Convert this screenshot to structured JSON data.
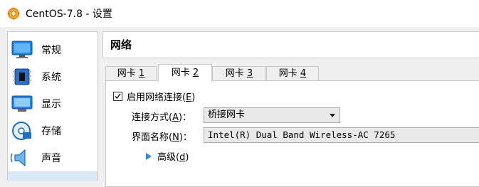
{
  "window": {
    "title": "CentOS-7.8 - 设置"
  },
  "sidebar": {
    "items": [
      {
        "label": "常规",
        "icon": "monitor-icon"
      },
      {
        "label": "系统",
        "icon": "chip-icon"
      },
      {
        "label": "显示",
        "icon": "display-icon"
      },
      {
        "label": "存储",
        "icon": "disk-icon"
      },
      {
        "label": "声音",
        "icon": "speaker-icon"
      }
    ]
  },
  "main": {
    "section_title": "网络",
    "tabs": [
      {
        "label": "网卡 ",
        "key": "1"
      },
      {
        "label": "网卡 ",
        "key": "2"
      },
      {
        "label": "网卡 ",
        "key": "3"
      },
      {
        "label": "网卡 ",
        "key": "4"
      }
    ],
    "active_tab": 1,
    "enable_network": {
      "label": "启用网络连接(",
      "key": "E",
      "suffix": ")",
      "checked": true
    },
    "connection_type": {
      "label": "连接方式(",
      "key": "A",
      "suffix": ")：",
      "value": "桥接网卡"
    },
    "interface_name": {
      "label": "界面名称(",
      "key": "N",
      "suffix": ")：",
      "value": "Intel(R) Dual Band Wireless-AC 7265"
    },
    "advanced": {
      "label": "高级(",
      "key": "d",
      "suffix": ")"
    }
  },
  "colors": {
    "accent": "#2a8fd8",
    "panel_border": "#c9c9c9",
    "selection": "#dbe8f7"
  }
}
